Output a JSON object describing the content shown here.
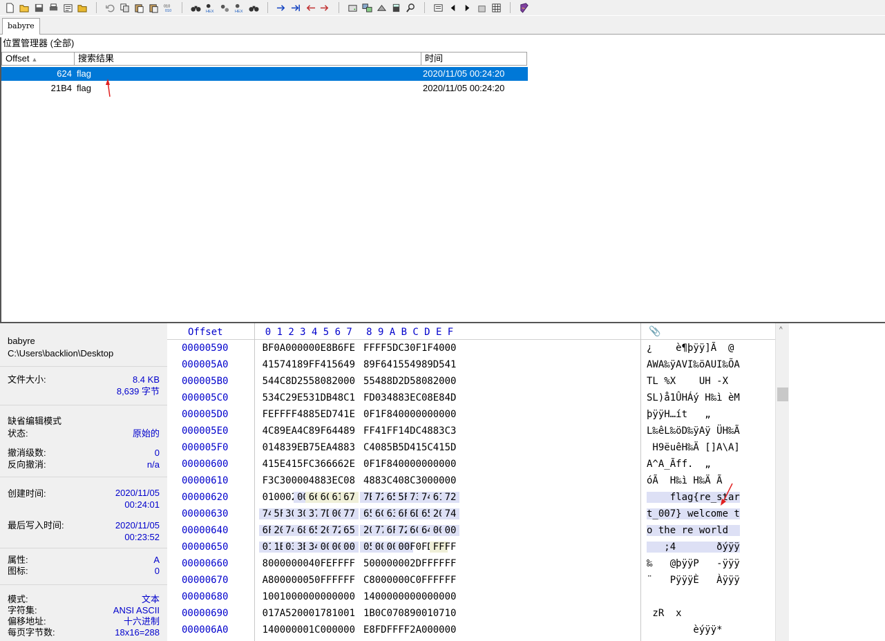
{
  "tab": {
    "label": "babyre"
  },
  "toolbar": {
    "icons": [
      "new-file-icon",
      "open-file-icon",
      "save-icon",
      "print-icon",
      "properties-icon",
      "open-folder-icon",
      "undo-icon",
      "copy-icon",
      "paste-icon",
      "paste-special-icon",
      "binary-icon",
      "find-icon",
      "find-hex-icon",
      "replace-icon",
      "replace-hex-icon",
      "find-next-icon",
      "goto-offset-icon",
      "goto-sector-icon",
      "back-icon",
      "forward-icon",
      "disk-icon",
      "clone-icon",
      "ram-icon",
      "calculator-icon",
      "search-icon",
      "template-icon",
      "prev-icon",
      "next-icon",
      "home-icon",
      "table-icon",
      "book-icon"
    ]
  },
  "position_manager": {
    "title": "位置管理器 (全部)",
    "columns": [
      "Offset",
      "搜索结果",
      "时间"
    ],
    "rows": [
      {
        "offset": "624",
        "result": "flag",
        "time": "2020/11/05  00:24:20"
      },
      {
        "offset": "21B4",
        "result": "flag",
        "time": "2020/11/05  00:24:20"
      }
    ]
  },
  "info": {
    "filename": "babyre",
    "path": "C:\\Users\\backlion\\Desktop",
    "size_label": "文件大小:",
    "size_kb": "8.4 KB",
    "size_bytes": "8,639 字节",
    "edit_mode_label": "缺省编辑模式",
    "state_label": "状态:",
    "state_value": "原始的",
    "undo_label": "撤消级数:",
    "undo_value": "0",
    "redo_label": "反向撤消:",
    "redo_value": "n/a",
    "created_label": "创建时间:",
    "created_date": "2020/11/05",
    "created_time": "00:24:01",
    "modified_label": "最后写入时间:",
    "modified_date": "2020/11/05",
    "modified_time": "00:23:52",
    "attr_label": "属性:",
    "attr_value": "A",
    "icon_label": "图标:",
    "icon_value": "0",
    "mode_label": "模式:",
    "mode_value": "文本",
    "charset_label": "字符集:",
    "charset_value": "ANSI ASCII",
    "offset_label": "偏移地址:",
    "offset_value": "十六进制",
    "bpp_label": "每页字节数:",
    "bpp_value": "18x16=288"
  },
  "hex": {
    "header_offset": "Offset",
    "header_cols": [
      "0",
      "1",
      "2",
      "3",
      "4",
      "5",
      "6",
      "7",
      "8",
      "9",
      "A",
      "B",
      "C",
      "D",
      "E",
      "F"
    ],
    "rows": [
      {
        "off": "00000590",
        "bytes": [
          "BF",
          "0A",
          "00",
          "00",
          "00",
          "E8",
          "B6",
          "FE",
          "FF",
          "FF",
          "5D",
          "C3",
          "0F",
          "1F",
          "40",
          "00"
        ],
        "ascii": "¿    è¶þÿÿ]Ã  @ "
      },
      {
        "off": "000005A0",
        "bytes": [
          "41",
          "57",
          "41",
          "89",
          "FF",
          "41",
          "56",
          "49",
          "89",
          "F6",
          "41",
          "55",
          "49",
          "89",
          "D5",
          "41"
        ],
        "ascii": "AWA‰ÿAVI‰öAUI‰ÕA"
      },
      {
        "off": "000005B0",
        "bytes": [
          "54",
          "4C",
          "8D",
          "25",
          "58",
          "08",
          "20",
          "00",
          "55",
          "48",
          "8D",
          "2D",
          "58",
          "08",
          "20",
          "00"
        ],
        "ascii": "TL %X    UH -X   "
      },
      {
        "off": "000005C0",
        "bytes": [
          "53",
          "4C",
          "29",
          "E5",
          "31",
          "DB",
          "48",
          "C1",
          "FD",
          "03",
          "48",
          "83",
          "EC",
          "08",
          "E8",
          "4D"
        ],
        "ascii": "SL)å1ÛHÁý H‰ì èM"
      },
      {
        "off": "000005D0",
        "bytes": [
          "FE",
          "FF",
          "FF",
          "48",
          "85",
          "ED",
          "74",
          "1E",
          "0F",
          "1F",
          "84",
          "00",
          "00",
          "00",
          "00",
          "00"
        ],
        "ascii": "þÿÿH…ít   „     "
      },
      {
        "off": "000005E0",
        "bytes": [
          "4C",
          "89",
          "EA",
          "4C",
          "89",
          "F6",
          "44",
          "89",
          "FF",
          "41",
          "FF",
          "14",
          "DC",
          "48",
          "83",
          "C3"
        ],
        "ascii": "L‰êL‰öD‰ÿAÿ ÜH‰Ã"
      },
      {
        "off": "000005F0",
        "bytes": [
          "01",
          "48",
          "39",
          "EB",
          "75",
          "EA",
          "48",
          "83",
          "C4",
          "08",
          "5B",
          "5D",
          "41",
          "5C",
          "41",
          "5D"
        ],
        "ascii": " H9ëuêH‰Ä []A\\A]"
      },
      {
        "off": "00000600",
        "bytes": [
          "41",
          "5E",
          "41",
          "5F",
          "C3",
          "66",
          "66",
          "2E",
          "0F",
          "1F",
          "84",
          "00",
          "00",
          "00",
          "00",
          "00"
        ],
        "ascii": "A^A_Ãff.  „     "
      },
      {
        "off": "00000610",
        "bytes": [
          "F3",
          "C3",
          "00",
          "00",
          "48",
          "83",
          "EC",
          "08",
          "48",
          "83",
          "C4",
          "08",
          "C3",
          "00",
          "00",
          "00"
        ],
        "ascii": "óÃ  H‰ì H‰Ä Ã   "
      },
      {
        "off": "00000620",
        "bytes": [
          "01",
          "00",
          "02",
          "00",
          "66",
          "6C",
          "61",
          "67",
          "7B",
          "72",
          "65",
          "5F",
          "73",
          "74",
          "61",
          "72"
        ],
        "ascii": "    flag{re_star"
      },
      {
        "off": "00000630",
        "bytes": [
          "74",
          "5F",
          "30",
          "30",
          "37",
          "7D",
          "00",
          "77",
          "65",
          "6C",
          "63",
          "6F",
          "6D",
          "65",
          "20",
          "74"
        ],
        "ascii": "t_007} welcome t"
      },
      {
        "off": "00000640",
        "bytes": [
          "6F",
          "20",
          "74",
          "68",
          "65",
          "20",
          "72",
          "65",
          "20",
          "77",
          "6F",
          "72",
          "6C",
          "64",
          "00",
          "00"
        ],
        "ascii": "o the re world  "
      },
      {
        "off": "00000650",
        "bytes": [
          "01",
          "1B",
          "03",
          "3B",
          "34",
          "00",
          "00",
          "00",
          "05",
          "00",
          "00",
          "00",
          "F0",
          "FD",
          "FF",
          "FF"
        ],
        "ascii": "   ;4       ðýÿÿ"
      },
      {
        "off": "00000660",
        "bytes": [
          "80",
          "00",
          "00",
          "00",
          "40",
          "FE",
          "FF",
          "FF",
          "50",
          "00",
          "00",
          "00",
          "2D",
          "FF",
          "FF",
          "FF"
        ],
        "ascii": "‰   @þÿÿP   -ÿÿÿ"
      },
      {
        "off": "00000670",
        "bytes": [
          "A8",
          "00",
          "00",
          "00",
          "50",
          "FF",
          "FF",
          "FF",
          "C8",
          "00",
          "00",
          "00",
          "C0",
          "FF",
          "FF",
          "FF"
        ],
        "ascii": "¨   PÿÿÿÈ   Àÿÿÿ"
      },
      {
        "off": "00000680",
        "bytes": [
          "10",
          "01",
          "00",
          "00",
          "00",
          "00",
          "00",
          "00",
          "14",
          "00",
          "00",
          "00",
          "00",
          "00",
          "00",
          "00"
        ],
        "ascii": "                "
      },
      {
        "off": "00000690",
        "bytes": [
          "01",
          "7A",
          "52",
          "00",
          "01",
          "78",
          "10",
          "01",
          "1B",
          "0C",
          "07",
          "08",
          "90",
          "01",
          "07",
          "10"
        ],
        "ascii": " zR  x          "
      },
      {
        "off": "000006A0",
        "bytes": [
          "14",
          "00",
          "00",
          "00",
          "1C",
          "00",
          "00",
          "00",
          "E8",
          "FD",
          "FF",
          "FF",
          "2A",
          "00",
          "00",
          "00"
        ],
        "ascii": "        èýÿÿ*   "
      }
    ]
  },
  "colors": {
    "offset_blue": "#0000cc",
    "selection": "#0078d7",
    "highlight": "#dde0f5"
  }
}
